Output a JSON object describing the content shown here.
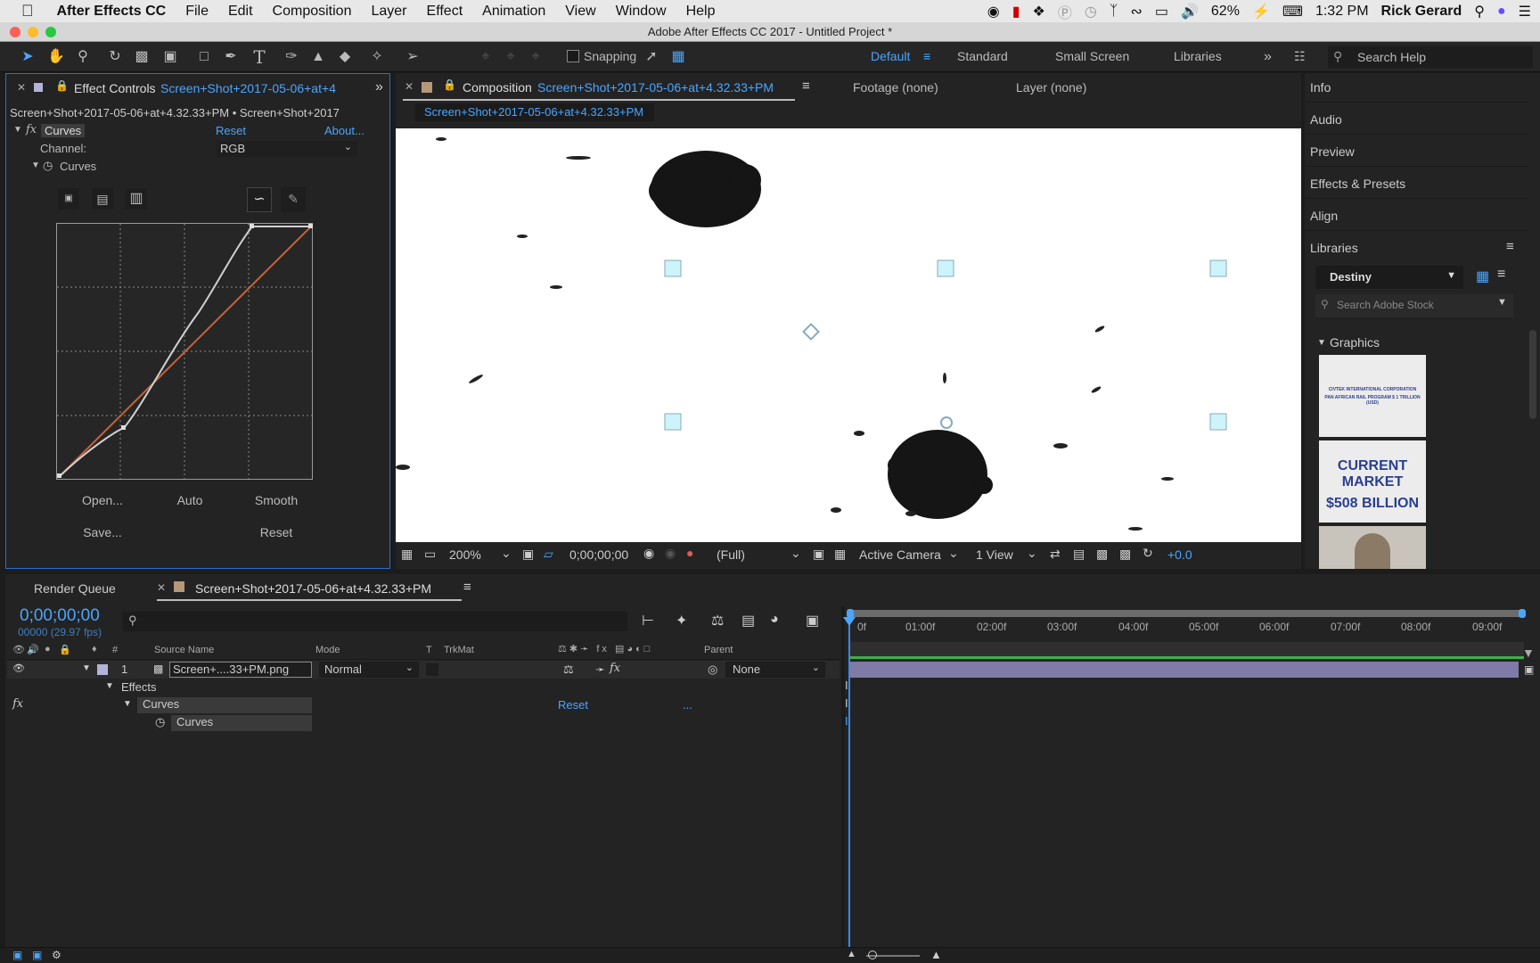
{
  "menubar": {
    "app_name": "After Effects CC",
    "items": [
      "File",
      "Edit",
      "Composition",
      "Layer",
      "Effect",
      "Animation",
      "View",
      "Window",
      "Help"
    ],
    "battery": "62%",
    "time": "1:32 PM",
    "user": "Rick Gerard"
  },
  "window": {
    "title": "Adobe After Effects CC 2017 - Untitled Project *"
  },
  "toolbar": {
    "snapping_label": "Snapping",
    "workspaces": [
      "Default",
      "Standard",
      "Small Screen",
      "Libraries"
    ],
    "active_workspace": "Default",
    "search_placeholder": "Search Help"
  },
  "effect_controls": {
    "tab_label": "Effect Controls",
    "tab_file": "Screen+Shot+2017-05-06+at+4",
    "breadcrumb": "Screen+Shot+2017-05-06+at+4.32.33+PM • Screen+Shot+2017",
    "effect_name": "Curves",
    "reset_label": "Reset",
    "about_label": "About...",
    "channel_label": "Channel:",
    "channel_value": "RGB",
    "curves_prop": "Curves",
    "buttons": {
      "open": "Open...",
      "auto": "Auto",
      "smooth": "Smooth",
      "save": "Save...",
      "reset": "Reset"
    }
  },
  "composition": {
    "tab_label": "Composition",
    "tab_file": "Screen+Shot+2017-05-06+at+4.32.33+PM",
    "footage_label": "Footage (none)",
    "layer_label": "Layer (none)",
    "subtab": "Screen+Shot+2017-05-06+at+4.32.33+PM",
    "zoom": "200%",
    "timecode": "0;00;00;00",
    "resolution": "(Full)",
    "camera": "Active Camera",
    "views": "1 View",
    "exposure": "+0.0"
  },
  "right_panel": {
    "items": [
      "Info",
      "Audio",
      "Preview",
      "Effects & Presets",
      "Align"
    ],
    "libraries_label": "Libraries",
    "library_name": "Destiny",
    "stock_placeholder": "Search Adobe Stock",
    "graphics_label": "Graphics",
    "thumb1_line1": "CIVTEK INTERNATIONAL CORPORATION",
    "thumb1_line2": "PAN AFRICAN RAIL PROGRAM $ 1 TRILLION (USD)",
    "thumb2_line1": "CURRENT MARKET",
    "thumb2_line2": "$508 BILLION"
  },
  "timeline": {
    "render_queue": "Render Queue",
    "comp_tab": "Screen+Shot+2017-05-06+at+4.32.33+PM",
    "timecode": "0;00;00;00",
    "frame_info": "00000 (29.97 fps)",
    "columns": {
      "num": "#",
      "source": "Source Name",
      "mode": "Mode",
      "t": "T",
      "trkmat": "TrkMat",
      "parent": "Parent"
    },
    "layer": {
      "index": "1",
      "name": "Screen+....33+PM.png",
      "mode": "Normal",
      "parent": "None"
    },
    "effects_label": "Effects",
    "curves_label": "Curves",
    "curves_prop": "Curves",
    "reset_label": "Reset",
    "dots": "...",
    "ruler": [
      "0f",
      "01:00f",
      "02:00f",
      "03:00f",
      "04:00f",
      "05:00f",
      "06:00f",
      "07:00f",
      "08:00f",
      "09:00f"
    ]
  }
}
